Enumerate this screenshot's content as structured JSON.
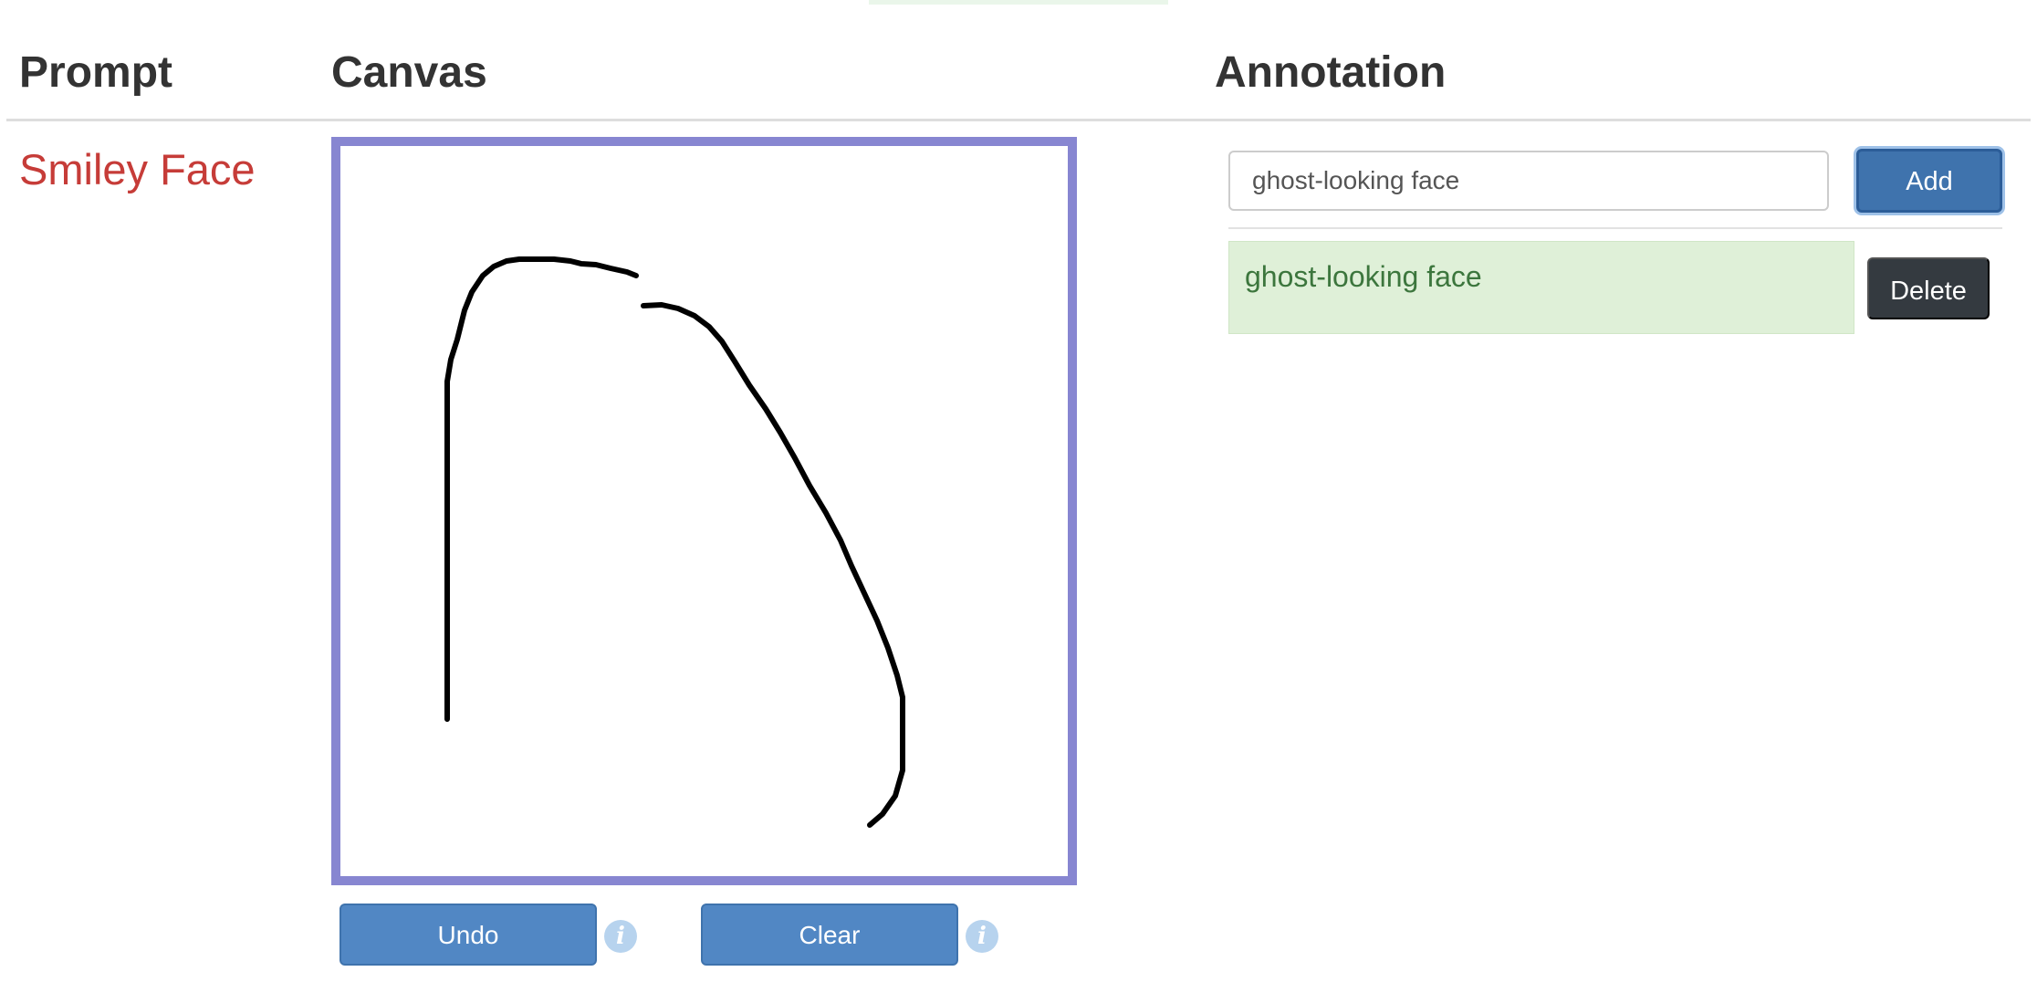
{
  "colors": {
    "prompt_text": "#c63c38",
    "canvas_border": "#8786d1",
    "primary_button": "#5187c4",
    "add_button": "#3f73ad",
    "annotation_bg": "#dff0d8",
    "annotation_text": "#3c763d",
    "delete_button": "#343a40",
    "info_icon": "#b7d3ee"
  },
  "headers": {
    "prompt": "Prompt",
    "canvas": "Canvas",
    "annotation": "Annotation"
  },
  "prompt": {
    "text": "Smiley Face"
  },
  "canvas": {
    "undo_label": "Undo",
    "clear_label": "Clear",
    "info_icon_glyph": "i",
    "info_icon_name": "info-icon"
  },
  "annotation": {
    "input_value": "ghost-looking face",
    "add_label": "Add",
    "items": [
      {
        "text": "ghost-looking face",
        "delete_label": "Delete"
      }
    ]
  }
}
